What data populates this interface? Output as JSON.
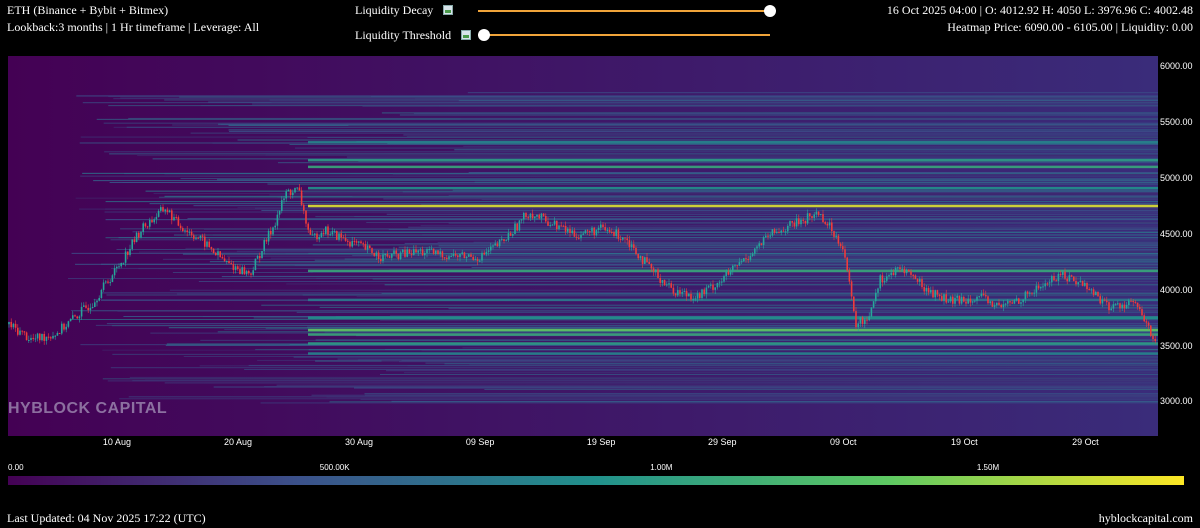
{
  "header": {
    "symbol_line": "ETH (Binance + Bybit + Bitmex)",
    "settings_line": "Lookback:3 months | 1 Hr timeframe | Leverage: All",
    "ohlc_line": "16 Oct 2025 04:00 | O: 4012.92 H: 4050 L: 3976.96 C: 4002.48",
    "heatmap_line": "Heatmap Price: 6090.00 - 6105.00 | Liquidity: 0.00"
  },
  "controls": {
    "decay_label": "Liquidity Decay",
    "decay_value": 1.0,
    "threshold_label": "Liquidity Threshold",
    "threshold_value": 0.0,
    "slider_icon": "image-icon",
    "track_color": "#f0a43a"
  },
  "watermark": "HYBLOCK CAPITAL",
  "chart_data": {
    "type": "heatmap",
    "title": "",
    "x_ticks": [
      "10 Aug",
      "20 Aug",
      "30 Aug",
      "09 Sep",
      "19 Sep",
      "29 Sep",
      "09 Oct",
      "19 Oct",
      "29 Oct"
    ],
    "y_ticks": [
      6000,
      5500,
      5000,
      4500,
      4000,
      3500,
      3000
    ],
    "ylim": [
      2700,
      6100
    ],
    "x_start": "01 Aug 2025",
    "x_end": "04 Nov 2025",
    "colorbar_ticks": [
      "0.00",
      "500.00K",
      "1.00M",
      "1.50M"
    ],
    "colorbar_range": [
      0,
      1800000
    ],
    "colors": {
      "background": "#440154",
      "low": "#3b528b",
      "mid": "#21918c",
      "high": "#5ec962",
      "max": "#fde725",
      "up_candle": "#26a69a",
      "down_candle": "#ef3b3b"
    },
    "price_path": [
      [
        "01 Aug",
        3700
      ],
      [
        "03 Aug",
        3560
      ],
      [
        "05 Aug",
        3620
      ],
      [
        "08 Aug",
        3900
      ],
      [
        "10 Aug",
        4200
      ],
      [
        "12 Aug",
        4550
      ],
      [
        "14 Aug",
        4740
      ],
      [
        "15 Aug",
        4600
      ],
      [
        "17 Aug",
        4450
      ],
      [
        "19 Aug",
        4250
      ],
      [
        "21 Aug",
        4150
      ],
      [
        "23 Aug",
        4600
      ],
      [
        "24 Aug",
        4880
      ],
      [
        "25 Aug",
        4900
      ],
      [
        "26 Aug",
        4450
      ],
      [
        "27 Aug",
        4550
      ],
      [
        "29 Aug",
        4450
      ],
      [
        "01 Sep",
        4300
      ],
      [
        "04 Sep",
        4350
      ],
      [
        "06 Sep",
        4320
      ],
      [
        "09 Sep",
        4300
      ],
      [
        "11 Sep",
        4450
      ],
      [
        "13 Sep",
        4700
      ],
      [
        "15 Sep",
        4600
      ],
      [
        "17 Sep",
        4500
      ],
      [
        "19 Sep",
        4550
      ],
      [
        "21 Sep",
        4480
      ],
      [
        "23 Sep",
        4200
      ],
      [
        "25 Sep",
        4000
      ],
      [
        "27 Sep",
        3950
      ],
      [
        "29 Sep",
        4100
      ],
      [
        "01 Oct",
        4300
      ],
      [
        "03 Oct",
        4500
      ],
      [
        "06 Oct",
        4650
      ],
      [
        "07 Oct",
        4700
      ],
      [
        "09 Oct",
        4400
      ],
      [
        "10 Oct",
        3700
      ],
      [
        "11 Oct",
        3750
      ],
      [
        "12 Oct",
        4100
      ],
      [
        "14 Oct",
        4200
      ],
      [
        "16 Oct",
        4000
      ],
      [
        "18 Oct",
        3900
      ],
      [
        "20 Oct",
        3950
      ],
      [
        "22 Oct",
        3850
      ],
      [
        "24 Oct",
        3950
      ],
      [
        "27 Oct",
        4150
      ],
      [
        "29 Oct",
        4050
      ],
      [
        "31 Oct",
        3850
      ],
      [
        "02 Nov",
        3900
      ],
      [
        "04 Nov",
        3500
      ]
    ],
    "liquidity_bands": [
      {
        "price": 5330,
        "level": 0.45
      },
      {
        "price": 5170,
        "level": 0.55
      },
      {
        "price": 5110,
        "level": 0.6
      },
      {
        "price": 4920,
        "level": 0.5
      },
      {
        "price": 4760,
        "level": 0.95
      },
      {
        "price": 4180,
        "level": 0.6
      },
      {
        "price": 3920,
        "level": 0.4
      },
      {
        "price": 3760,
        "level": 0.5
      },
      {
        "price": 3650,
        "level": 0.75
      },
      {
        "price": 3610,
        "level": 0.6
      },
      {
        "price": 3530,
        "level": 0.55
      },
      {
        "price": 3440,
        "level": 0.45
      }
    ]
  },
  "footer": {
    "last_updated": "Last Updated: 04 Nov 2025 17:22 (UTC)",
    "site": "hyblockcapital.com"
  }
}
